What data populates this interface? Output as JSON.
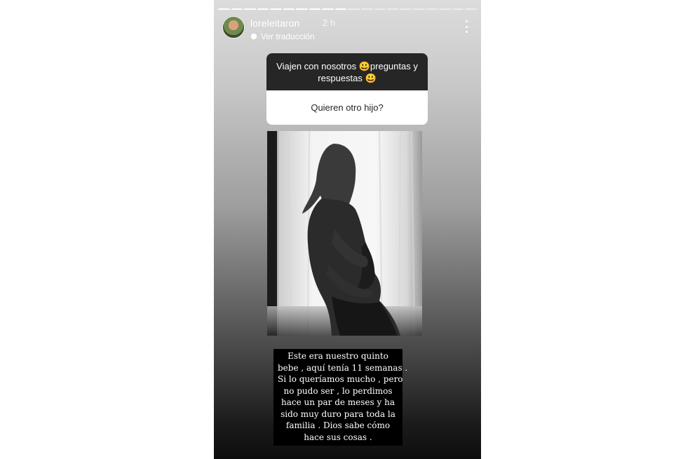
{
  "story": {
    "progress_total": 20,
    "progress_done": 10,
    "header": {
      "username": "loreleitaron",
      "time": "2 h",
      "translate_label": "Ver traducción",
      "more_icon": "more-vertical-icon"
    },
    "question_sticker": {
      "title": "Viajen con nosotros 😃preguntas y respuestas 😃",
      "question": "Quieren otro hijo?"
    },
    "caption_lines": [
      "Este era nuestro quinto",
      "bebe , aquí tenía 11 semanas .",
      "Si lo queríamos mucho , pero",
      "no pudo ser , lo perdimos",
      "hace un par de meses y ha",
      "sido muy duro para toda la",
      "familia . Dios sabe cómo",
      "hace sus cosas ."
    ]
  }
}
